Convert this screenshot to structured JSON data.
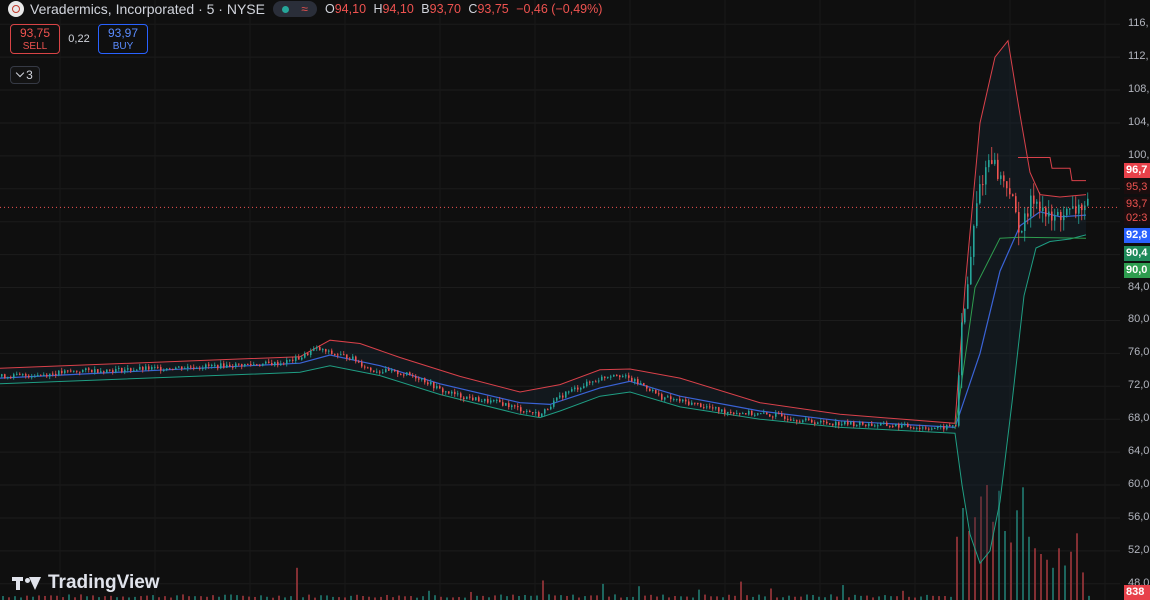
{
  "header": {
    "symbol_title": "Veradermics, Incorporated · 5 · NYSE",
    "wave_icon": "≈",
    "ohlc": {
      "o_label": "O",
      "o_value": "94,10",
      "h_label": "H",
      "h_value": "94,10",
      "b_label": "B",
      "b_value": "93,70",
      "c_label": "C",
      "c_value": "93,75",
      "change": "−0,46 (−0,49%)"
    }
  },
  "trade": {
    "sell_price": "93,75",
    "sell_label": "SELL",
    "spread": "0,22",
    "buy_price": "93,97",
    "buy_label": "BUY"
  },
  "indicators_toggle": {
    "count": "3"
  },
  "price_axis": {
    "ticks": [
      {
        "label": "116,"
      },
      {
        "label": "112,"
      },
      {
        "label": "108,"
      },
      {
        "label": "104,"
      },
      {
        "label": "100,"
      },
      {
        "label": "84,0"
      },
      {
        "label": "80,0"
      },
      {
        "label": "76,0"
      },
      {
        "label": "72,0"
      },
      {
        "label": "68,0"
      },
      {
        "label": "64,0"
      },
      {
        "label": "60,0"
      },
      {
        "label": "56,0"
      },
      {
        "label": "52,0"
      },
      {
        "label": "48,0"
      }
    ]
  },
  "price_tags": [
    {
      "label": "96,7",
      "color": "#e8414a"
    },
    {
      "label": "95,3",
      "color": "#1a0d0e",
      "text_color": "#ef5350"
    },
    {
      "label": "93,7",
      "color": "#1a0d0e",
      "text_color": "#ef5350"
    },
    {
      "label": "02:3",
      "color": "#1a0d0e",
      "text_color": "#ef5350"
    },
    {
      "label": "92,8",
      "color": "#2962ff"
    },
    {
      "label": "90,4",
      "color": "#1e8a5a"
    },
    {
      "label": "90,0",
      "color": "#2e9d4f"
    },
    {
      "label": "838",
      "color": "#e8414a"
    }
  ],
  "brand": {
    "name": "TradingView"
  },
  "colors": {
    "up": "#26a69a",
    "down": "#ef5350",
    "bb_upper": "#d9414a",
    "bb_lower": "#1f9e83",
    "basis": "#3a63d6",
    "current_price_line": "#ef5350",
    "background": "#0f0f0f"
  },
  "chart_data": {
    "type": "candlestick",
    "timeframe": "5",
    "y_range": [
      47,
      117
    ],
    "last_price": 93.75,
    "close_path": [
      [
        0,
        73.2
      ],
      [
        40,
        73.4
      ],
      [
        80,
        73.9
      ],
      [
        120,
        74.0
      ],
      [
        160,
        74.2
      ],
      [
        200,
        74.4
      ],
      [
        240,
        74.6
      ],
      [
        280,
        74.8
      ],
      [
        300,
        75.5
      ],
      [
        315,
        76.6
      ],
      [
        330,
        76.0
      ],
      [
        350,
        75.5
      ],
      [
        370,
        74.0
      ],
      [
        400,
        73.6
      ],
      [
        420,
        73.0
      ],
      [
        440,
        71.5
      ],
      [
        460,
        70.8
      ],
      [
        480,
        70.3
      ],
      [
        500,
        70.0
      ],
      [
        520,
        69.2
      ],
      [
        540,
        68.5
      ],
      [
        550,
        69.8
      ],
      [
        565,
        71.2
      ],
      [
        580,
        72.0
      ],
      [
        600,
        73.0
      ],
      [
        615,
        73.6
      ],
      [
        630,
        72.8
      ],
      [
        645,
        72.0
      ],
      [
        660,
        70.7
      ],
      [
        680,
        70.2
      ],
      [
        700,
        69.7
      ],
      [
        720,
        69.0
      ],
      [
        740,
        68.8
      ],
      [
        760,
        68.6
      ],
      [
        780,
        68.4
      ],
      [
        800,
        67.9
      ],
      [
        820,
        67.6
      ],
      [
        840,
        67.5
      ],
      [
        860,
        67.4
      ],
      [
        880,
        67.3
      ],
      [
        900,
        67.2
      ],
      [
        920,
        67.0
      ],
      [
        940,
        66.9
      ],
      [
        955,
        67.3
      ],
      [
        960,
        78.0
      ],
      [
        966,
        83.0
      ],
      [
        972,
        90.0
      ],
      [
        978,
        96.0
      ],
      [
        984,
        98.0
      ],
      [
        990,
        100.5
      ],
      [
        996,
        98.0
      ],
      [
        1002,
        97.0
      ],
      [
        1008,
        96.5
      ],
      [
        1014,
        93.0
      ],
      [
        1020,
        91.0
      ],
      [
        1026,
        92.5
      ],
      [
        1032,
        95.0
      ],
      [
        1038,
        94.5
      ],
      [
        1044,
        93.0
      ],
      [
        1050,
        92.0
      ],
      [
        1056,
        92.6
      ],
      [
        1062,
        93.1
      ],
      [
        1068,
        92.9
      ],
      [
        1074,
        93.3
      ],
      [
        1080,
        94.0
      ],
      [
        1086,
        93.75
      ]
    ],
    "basis_path": [
      [
        0,
        73.0
      ],
      [
        300,
        74.8
      ],
      [
        330,
        75.8
      ],
      [
        380,
        74.5
      ],
      [
        440,
        72.3
      ],
      [
        520,
        70.0
      ],
      [
        550,
        69.8
      ],
      [
        600,
        71.8
      ],
      [
        630,
        72.6
      ],
      [
        680,
        70.8
      ],
      [
        760,
        69.0
      ],
      [
        840,
        67.8
      ],
      [
        955,
        67.0
      ],
      [
        980,
        76.0
      ],
      [
        1000,
        86.0
      ],
      [
        1020,
        91.5
      ],
      [
        1040,
        93.2
      ],
      [
        1060,
        92.6
      ],
      [
        1086,
        92.8
      ]
    ],
    "upper_path": [
      [
        0,
        74.2
      ],
      [
        300,
        75.6
      ],
      [
        330,
        77.6
      ],
      [
        360,
        77.2
      ],
      [
        400,
        75.5
      ],
      [
        460,
        73.2
      ],
      [
        520,
        71.3
      ],
      [
        560,
        72.2
      ],
      [
        600,
        74.0
      ],
      [
        630,
        74.1
      ],
      [
        680,
        73.0
      ],
      [
        760,
        70.0
      ],
      [
        840,
        68.6
      ],
      [
        955,
        67.5
      ],
      [
        965,
        84.0
      ],
      [
        980,
        104.0
      ],
      [
        995,
        112.0
      ],
      [
        1008,
        114.0
      ],
      [
        1020,
        105.0
      ],
      [
        1030,
        98.0
      ],
      [
        1040,
        95.3
      ],
      [
        1060,
        95.0
      ],
      [
        1086,
        95.3
      ]
    ],
    "lower_path": [
      [
        0,
        72.3
      ],
      [
        300,
        73.7
      ],
      [
        330,
        74.5
      ],
      [
        380,
        73.3
      ],
      [
        440,
        71.0
      ],
      [
        520,
        68.6
      ],
      [
        540,
        68.2
      ],
      [
        560,
        69.0
      ],
      [
        600,
        70.8
      ],
      [
        630,
        71.3
      ],
      [
        680,
        69.5
      ],
      [
        760,
        68.0
      ],
      [
        840,
        67.0
      ],
      [
        955,
        66.3
      ],
      [
        962,
        60.0
      ],
      [
        970,
        54.0
      ],
      [
        980,
        50.5
      ],
      [
        990,
        52.0
      ],
      [
        1000,
        58.0
      ],
      [
        1012,
        70.0
      ],
      [
        1024,
        83.0
      ],
      [
        1036,
        88.8
      ],
      [
        1050,
        89.6
      ],
      [
        1070,
        89.9
      ],
      [
        1086,
        90.4
      ]
    ],
    "ma_fast_path": [
      [
        955,
        66.8
      ],
      [
        975,
        84.0
      ],
      [
        1000,
        90.0
      ],
      [
        1020,
        90.1
      ],
      [
        1086,
        90.0
      ]
    ],
    "volume_max": 838,
    "volume_spikes": [
      [
        295,
        0.28
      ],
      [
        430,
        0.08
      ],
      [
        470,
        0.07
      ],
      [
        540,
        0.17
      ],
      [
        600,
        0.14
      ],
      [
        640,
        0.12
      ],
      [
        700,
        0.09
      ],
      [
        740,
        0.16
      ],
      [
        770,
        0.1
      ],
      [
        840,
        0.13
      ],
      [
        900,
        0.08
      ],
      [
        958,
        0.55
      ],
      [
        964,
        0.8
      ],
      [
        970,
        0.6
      ],
      [
        976,
        0.72
      ],
      [
        982,
        0.9
      ],
      [
        988,
        1.0
      ],
      [
        994,
        0.68
      ],
      [
        1000,
        0.95
      ],
      [
        1006,
        0.6
      ],
      [
        1012,
        0.5
      ],
      [
        1018,
        0.78
      ],
      [
        1024,
        0.98
      ],
      [
        1030,
        0.55
      ],
      [
        1036,
        0.45
      ],
      [
        1042,
        0.4
      ],
      [
        1048,
        0.35
      ],
      [
        1054,
        0.28
      ],
      [
        1060,
        0.45
      ],
      [
        1066,
        0.3
      ],
      [
        1072,
        0.42
      ],
      [
        1078,
        0.58
      ],
      [
        1084,
        0.1
      ]
    ]
  }
}
